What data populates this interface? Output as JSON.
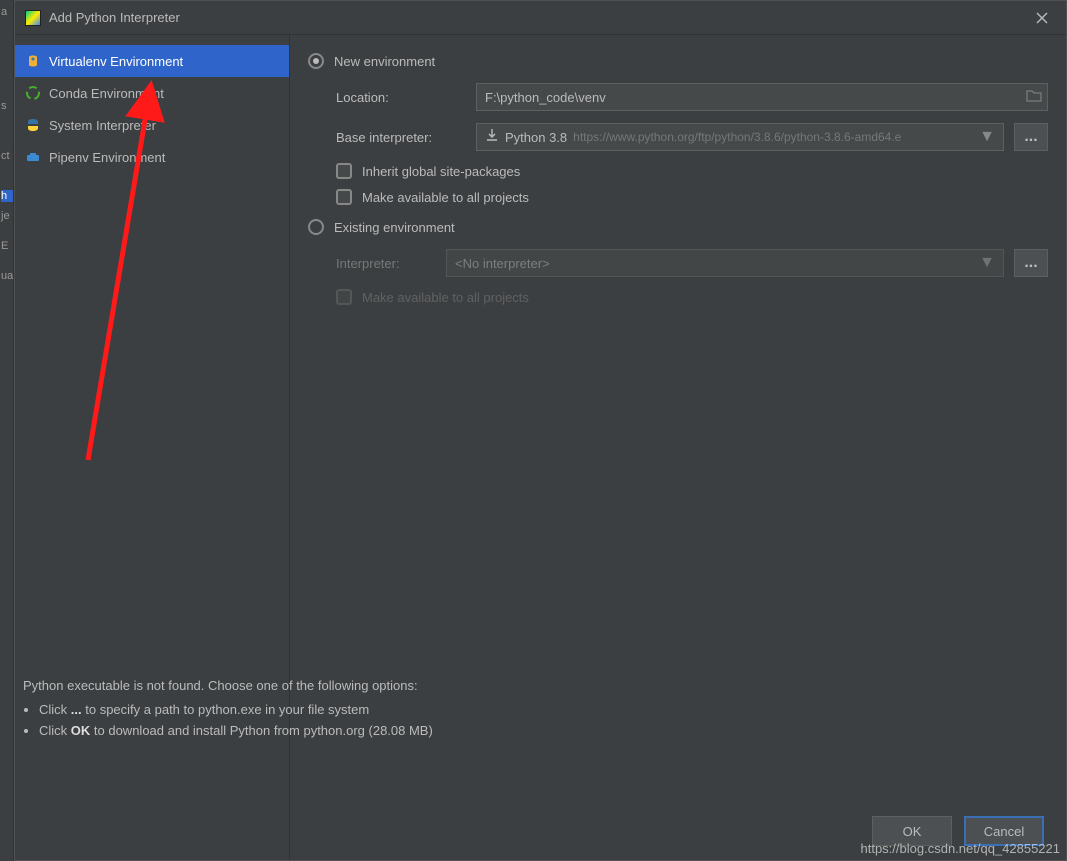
{
  "titlebar": {
    "title": "Add Python Interpreter"
  },
  "sidebar": {
    "items": [
      {
        "label": "Virtualenv Environment"
      },
      {
        "label": "Conda Environment"
      },
      {
        "label": "System Interpreter"
      },
      {
        "label": "Pipenv Environment"
      }
    ]
  },
  "newenv": {
    "radio_label": "New environment",
    "location_label": "Location:",
    "location_value": "F:\\python_code\\venv",
    "base_label": "Base interpreter:",
    "base_main": "Python 3.8",
    "base_sub": "https://www.python.org/ftp/python/3.8.6/python-3.8.6-amd64.e",
    "inherit_label": "Inherit global site-packages",
    "make_avail_label": "Make available to all projects"
  },
  "existing": {
    "radio_label": "Existing environment",
    "interpreter_label": "Interpreter:",
    "interpreter_value": "<No interpreter>",
    "make_avail_label": "Make available to all projects"
  },
  "hints": {
    "heading": "Python executable is not found. Choose one of the following options:",
    "bullet1_prefix": "Click ",
    "bullet1_strong": "...",
    "bullet1_suffix": " to specify a path to python.exe in your file system",
    "bullet2_prefix": "Click ",
    "bullet2_strong": "OK",
    "bullet2_suffix": " to download and install Python from python.org (28.08 MB)"
  },
  "footer": {
    "ok": "OK",
    "cancel": "Cancel"
  },
  "more_btn": "...",
  "watermark": "https://blog.csdn.net/qq_42855221",
  "gutter": {
    "t0": "a",
    "t1": "s",
    "t2": "ct",
    "t3": "h",
    "t4": "je",
    "t5": "E",
    "t6": "ua"
  }
}
